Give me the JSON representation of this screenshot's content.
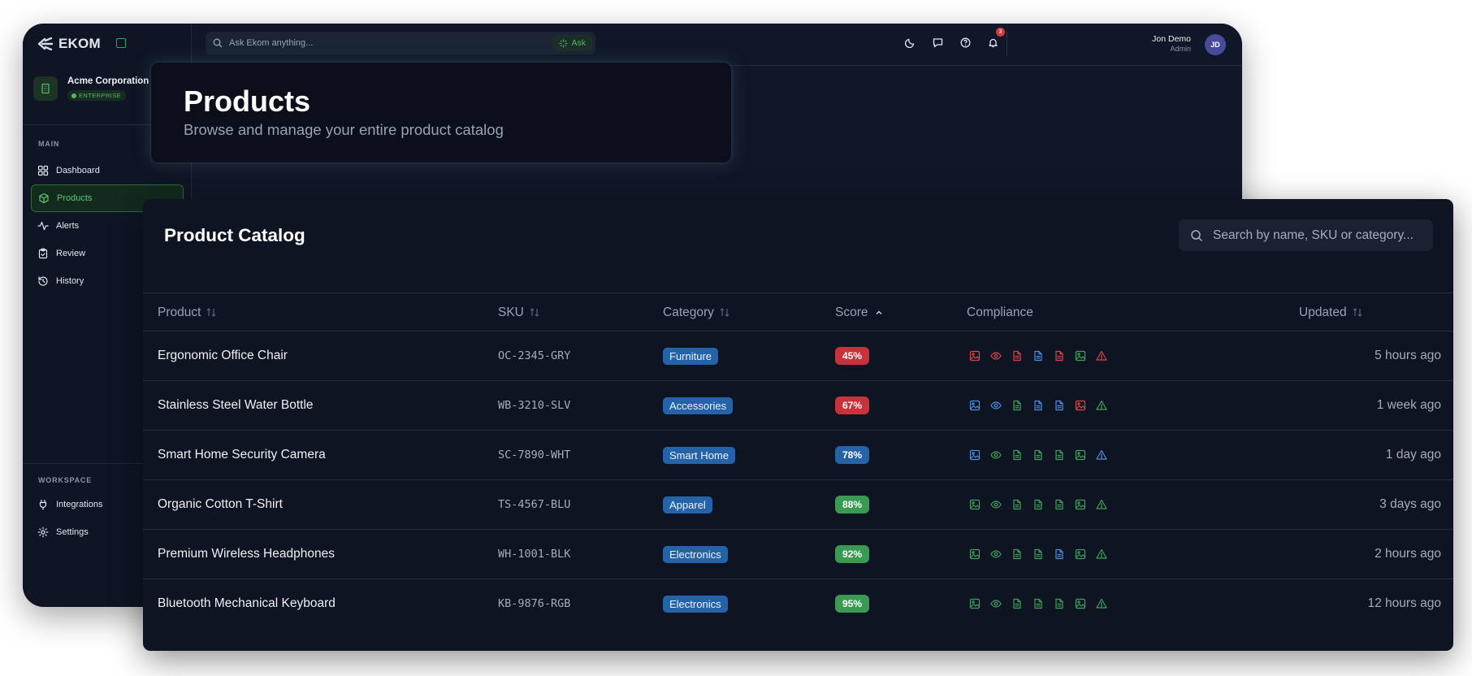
{
  "app": {
    "brand": "EKOM",
    "org": {
      "name": "Acme Corporation",
      "plan": "ENTERPRISE"
    },
    "nav_main_label": "MAIN",
    "nav_main": [
      {
        "label": "Dashboard",
        "icon": "grid-icon"
      },
      {
        "label": "Products",
        "icon": "box-icon",
        "active": true
      },
      {
        "label": "Alerts",
        "icon": "activity-icon"
      },
      {
        "label": "Review",
        "icon": "clipboard-icon"
      },
      {
        "label": "History",
        "icon": "history-icon"
      }
    ],
    "nav_workspace_label": "WORKSPACE",
    "nav_workspace": [
      {
        "label": "Integrations",
        "icon": "plug-icon"
      },
      {
        "label": "Settings",
        "icon": "gear-icon"
      }
    ],
    "search_placeholder": "Ask Ekom anything...",
    "ask_label": "Ask",
    "notification_count": "3",
    "user": {
      "name": "Jon Demo",
      "role": "Admin",
      "initials": "JD"
    },
    "accent_color": "#4fb86a"
  },
  "page_header": {
    "title": "Products",
    "subtitle": "Browse and manage your entire product catalog"
  },
  "catalog": {
    "title": "Product Catalog",
    "search_placeholder": "Search by name, SKU or category...",
    "columns": {
      "product": "Product",
      "sku": "SKU",
      "category": "Category",
      "score": "Score",
      "compliance": "Compliance",
      "updated": "Updated"
    },
    "sorted_column": "Score",
    "rows": [
      {
        "product": "Ergonomic Office Chair",
        "sku": "OC-2345-GRY",
        "category": "Furniture",
        "score": "45%",
        "updated": "5 hours ago",
        "compliance": [
          "red",
          "red",
          "red",
          "blue",
          "red",
          "green",
          "red"
        ]
      },
      {
        "product": "Stainless Steel Water Bottle",
        "sku": "WB-3210-SLV",
        "category": "Accessories",
        "score": "67%",
        "updated": "1 week ago",
        "compliance": [
          "blue",
          "blue",
          "green",
          "blue",
          "blue",
          "red",
          "green"
        ]
      },
      {
        "product": "Smart Home Security Camera",
        "sku": "SC-7890-WHT",
        "category": "Smart Home",
        "score": "78%",
        "updated": "1 day ago",
        "compliance": [
          "blue",
          "green",
          "green",
          "green",
          "green",
          "green",
          "blue"
        ]
      },
      {
        "product": "Organic Cotton T-Shirt",
        "sku": "TS-4567-BLU",
        "category": "Apparel",
        "score": "88%",
        "updated": "3 days ago",
        "compliance": [
          "green",
          "green",
          "green",
          "green",
          "green",
          "green",
          "green"
        ]
      },
      {
        "product": "Premium Wireless Headphones",
        "sku": "WH-1001-BLK",
        "category": "Electronics",
        "score": "92%",
        "updated": "2 hours ago",
        "compliance": [
          "green",
          "green",
          "green",
          "green",
          "blue",
          "green",
          "green"
        ]
      },
      {
        "product": "Bluetooth Mechanical Keyboard",
        "sku": "KB-9876-RGB",
        "category": "Electronics",
        "score": "95%",
        "updated": "12 hours ago",
        "compliance": [
          "green",
          "green",
          "green",
          "green",
          "green",
          "green",
          "green"
        ]
      }
    ],
    "compliance_icons": [
      "image-icon",
      "eye-icon",
      "document-icon",
      "document-icon",
      "document-icon",
      "image-icon",
      "warning-icon"
    ],
    "status_colors": {
      "red": "#d9464b",
      "blue": "#4a90e2",
      "green": "#3fa25a"
    },
    "score_colors": {
      "low": "#c8323b",
      "mid": "#2563a8",
      "high": "#3a9a52"
    }
  }
}
